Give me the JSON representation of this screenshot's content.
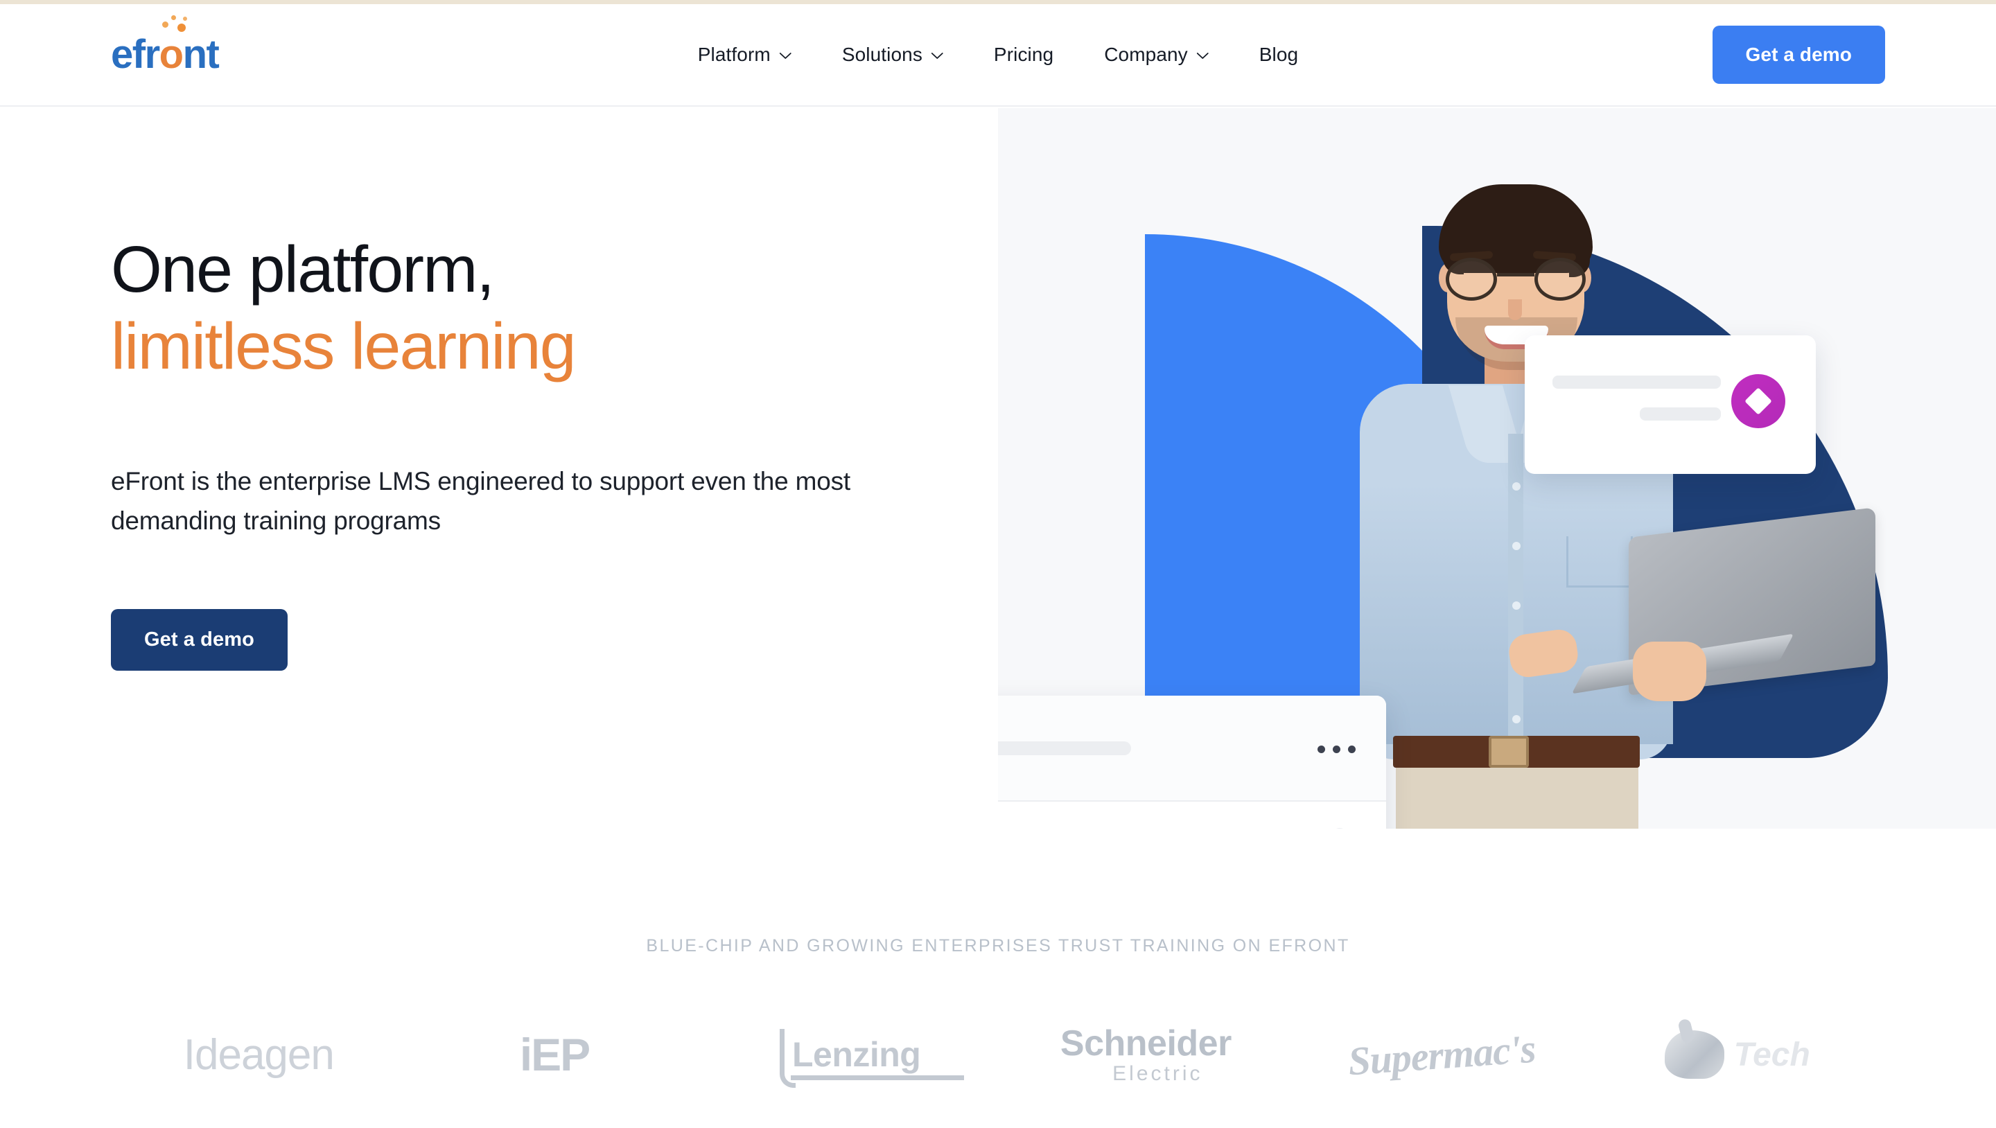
{
  "brand": {
    "logo_text_before": "efr",
    "logo_text_o": "o",
    "logo_text_after": "nt",
    "logo_full": "efront",
    "accent_blue": "#2a6fc0",
    "accent_orange": "#e8833a"
  },
  "header": {
    "nav": [
      {
        "label": "Platform",
        "has_dropdown": true
      },
      {
        "label": "Solutions",
        "has_dropdown": true
      },
      {
        "label": "Pricing",
        "has_dropdown": false
      },
      {
        "label": "Company",
        "has_dropdown": true
      },
      {
        "label": "Blog",
        "has_dropdown": false
      }
    ],
    "cta_label": "Get a demo",
    "cta_color": "#3b7ef2"
  },
  "hero": {
    "title_line1": "One platform,",
    "title_line2": "limitless learning",
    "subtitle": "eFront is the enterprise LMS engineered to support even the most demanding training programs",
    "cta_label": "Get a demo",
    "cta_color": "#1b3d74",
    "art": {
      "panel_bg": "#f7f8fa",
      "shape_blue": "#3b82f6",
      "shape_navy": "#1e3f75",
      "badge_color": "#c02ec0",
      "badge_icon": "diamond-icon",
      "chart_color": "#2f8a4d",
      "menu_icon": "ellipsis-icon"
    }
  },
  "trust": {
    "label": "Blue-chip and growing enterprises trust training on eFront",
    "logos": [
      {
        "name": "Ideagen"
      },
      {
        "name": "iEP"
      },
      {
        "name": "Lenzing"
      },
      {
        "name": "Schneider",
        "sub": "Electric"
      },
      {
        "name": "Supermac's"
      },
      {
        "name": "Tech"
      }
    ]
  }
}
